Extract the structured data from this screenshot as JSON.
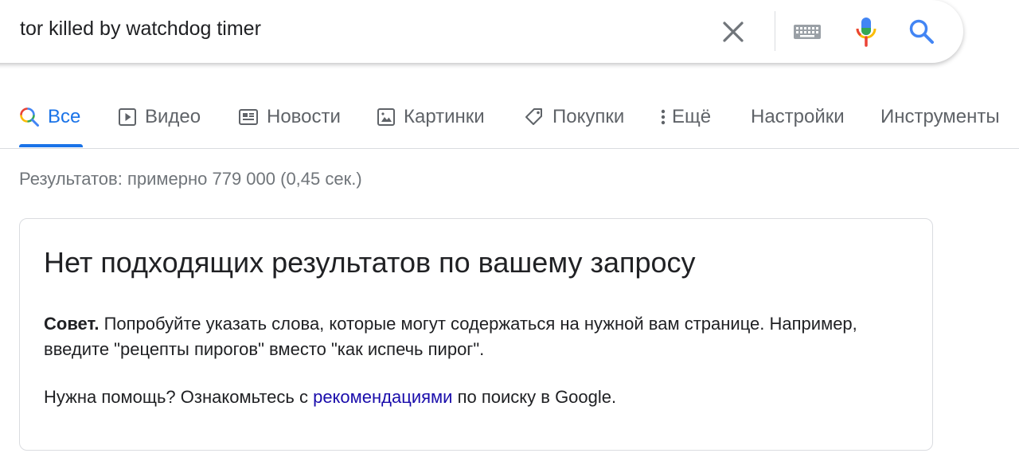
{
  "search": {
    "query": "tor killed by watchdog timer",
    "icons": [
      "close-icon",
      "keyboard-icon",
      "mic-icon",
      "search-icon"
    ]
  },
  "tabs": [
    {
      "label": "Все",
      "icon": "search-icon",
      "active": true
    },
    {
      "label": "Видео",
      "icon": "play-icon"
    },
    {
      "label": "Новости",
      "icon": "newspaper-icon"
    },
    {
      "label": "Картинки",
      "icon": "image-icon"
    },
    {
      "label": "Покупки",
      "icon": "tag-icon"
    },
    {
      "label": "Ещё",
      "icon": "more-vert-icon"
    },
    {
      "label": "Настройки"
    },
    {
      "label": "Инструменты"
    }
  ],
  "stats": "Результатов: примерно 779 000 (0,45 сек.)",
  "card": {
    "title": "Нет подходящих результатов по вашему запросу",
    "tip_bold": "Совет.",
    "tip_text": " Попробуйте указать слова, которые могут содержаться на нужной вам странице. Например, введите \"рецепты пирогов\" вместо \"как испечь пирог\".",
    "help_prefix": "Нужна помощь? Ознакомьтесь с ",
    "help_link": "рекомендациями",
    "help_suffix": " по поиску в Google."
  },
  "colors": {
    "accent": "#1a73e8",
    "link": "#1a0dab",
    "muted": "#70757a",
    "text": "#202124"
  }
}
